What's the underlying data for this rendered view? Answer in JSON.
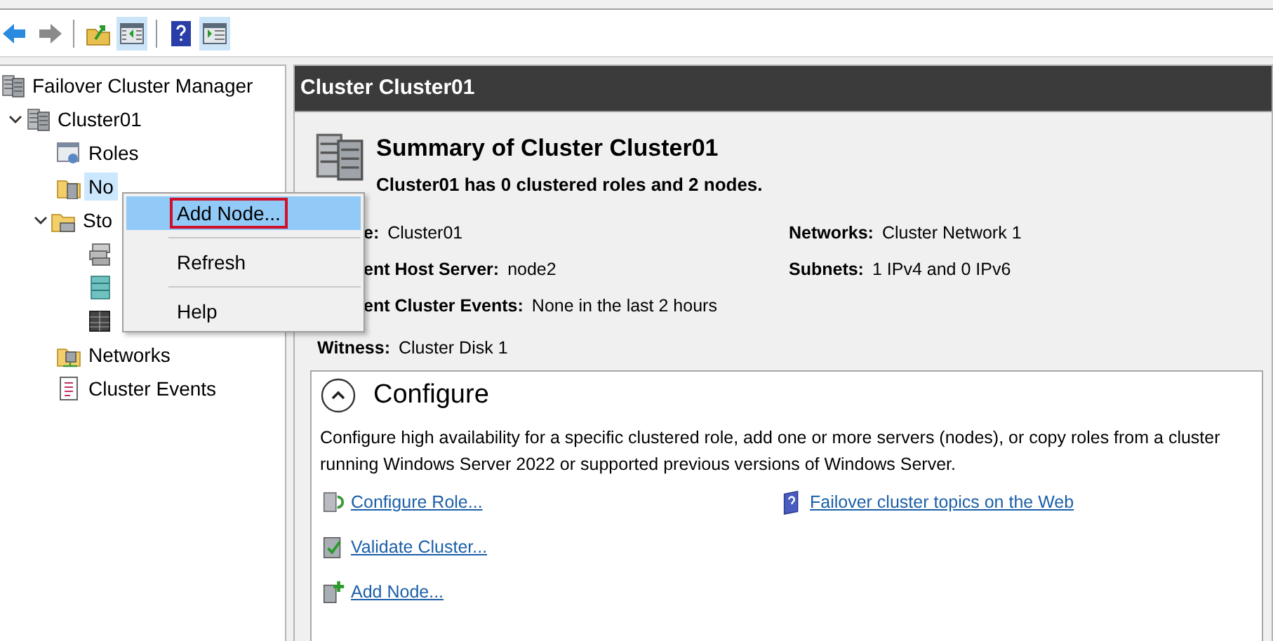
{
  "toolbar": {
    "buttons": [
      {
        "kind": "back",
        "on": false
      },
      {
        "kind": "forward",
        "on": false
      },
      {
        "kind": "up",
        "on": false
      },
      {
        "kind": "pane",
        "on": true
      },
      {
        "kind": "help",
        "on": false
      },
      {
        "kind": "action",
        "on": true
      }
    ]
  },
  "tree": [
    {
      "label": "Failover Cluster Manager",
      "kind": "manager",
      "selected": false,
      "children": [
        {
          "label": "Cluster01",
          "kind": "cluster",
          "expanded": true,
          "selected": false,
          "children": [
            {
              "label": "Roles",
              "kind": "roles",
              "selected": false
            },
            {
              "label": "No",
              "kind": "nodes",
              "selected": true
            },
            {
              "label": "Sto",
              "kind": "storage",
              "expanded": true,
              "selected": false,
              "children": [
                {
                  "kind": "disks"
                },
                {
                  "kind": "pools"
                },
                {
                  "kind": "enclosures"
                }
              ]
            },
            {
              "label": "Networks",
              "kind": "networks",
              "selected": false
            },
            {
              "label": "Cluster Events",
              "kind": "events",
              "selected": false
            }
          ]
        }
      ]
    }
  ],
  "context_menu": {
    "items": [
      {
        "label": "Add Node...",
        "selected": true
      },
      {
        "label": "Refresh",
        "selected": false
      },
      {
        "label": "Help",
        "selected": false
      }
    ]
  },
  "panel": {
    "title": "Cluster Cluster01",
    "summary": {
      "title": "Summary of Cluster Cluster01",
      "subtitle": "Cluster01 has 0 clustered roles and 2 nodes.",
      "facts_left": [
        {
          "label": "e:",
          "value": "Cluster01"
        },
        {
          "label": "ent Host Server:",
          "value": "node2"
        },
        {
          "label": "ent Cluster Events:",
          "value": "None in the last 2 hours"
        },
        {
          "label": "Witness:",
          "value": "Cluster Disk 1"
        }
      ],
      "facts_right": [
        {
          "label": "Networks:",
          "value": "Cluster Network 1"
        },
        {
          "label": "Subnets:",
          "value": "1 IPv4 and 0 IPv6"
        }
      ]
    },
    "configure": {
      "title": "Configure",
      "expanded": true,
      "description": "Configure high availability for a specific clustered role, add one or more servers (nodes), or copy roles from a cluster running Windows Server 2022 or supported previous versions of Windows Server.",
      "links_left": [
        {
          "label": "Configure Role...",
          "kind": "role"
        },
        {
          "label": "Validate Cluster...",
          "kind": "validate"
        },
        {
          "label": "Add Node...",
          "kind": "add"
        }
      ],
      "links_right": [
        {
          "label": "Failover cluster topics on the Web",
          "kind": "help"
        }
      ]
    }
  }
}
